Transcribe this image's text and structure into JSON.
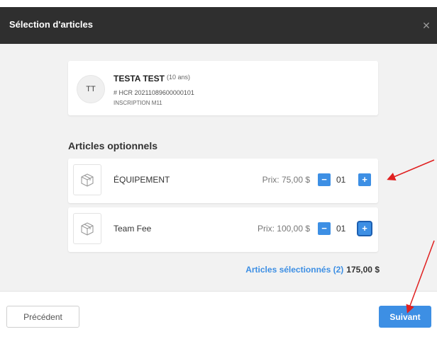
{
  "modal": {
    "title": "Sélection d'articles",
    "close_icon": "close-icon",
    "close_glyph": "✕"
  },
  "player": {
    "initials": "TT",
    "name": "TESTA TEST",
    "age": "(10 ans)",
    "id": "# HCR 20211089600000101",
    "registration": "INSCRIPTION M11"
  },
  "section_title": "Articles optionnels",
  "articles": [
    {
      "name": "ÉQUIPEMENT",
      "price": "Prix: 75,00 $",
      "quantity": "01",
      "minus": "−",
      "plus": "+",
      "icon": "box-icon"
    },
    {
      "name": "Team Fee",
      "price": "Prix: 100,00 $",
      "quantity": "01",
      "minus": "−",
      "plus": "+",
      "icon": "box-icon"
    }
  ],
  "summary": {
    "selected_label": "Articles sélectionnés (2)",
    "total": "175,00 $"
  },
  "footer": {
    "previous_label": "Précédent",
    "next_label": "Suivant"
  },
  "colors": {
    "header_bg": "#2f2f2f",
    "accent": "#3d8fe4",
    "annotation_arrow": "#e02020"
  }
}
